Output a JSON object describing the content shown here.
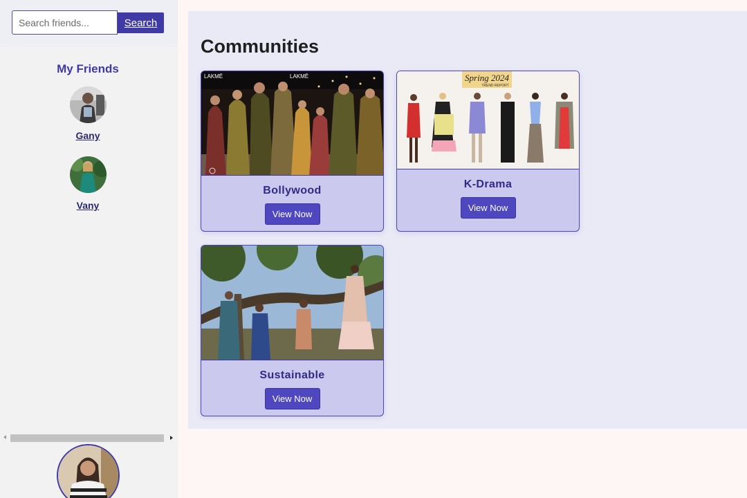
{
  "search": {
    "placeholder": "Search friends...",
    "button_label": "Search"
  },
  "friends": {
    "title": "My Friends",
    "items": [
      {
        "name": "Gany"
      },
      {
        "name": "Vany"
      }
    ]
  },
  "main": {
    "title": "Communities",
    "communities": [
      {
        "name": "Bollywood",
        "button_label": "View Now",
        "image_text": "LAKMĒ"
      },
      {
        "name": "K-Drama",
        "button_label": "View Now",
        "image_text": "Spring 2024",
        "image_subtext": "TREND REPORT"
      },
      {
        "name": "Sustainable",
        "button_label": "View Now"
      }
    ]
  },
  "colors": {
    "accent": "#3f3aa6",
    "card_bg": "#ccc9ee",
    "main_bg": "#eaeaf7"
  }
}
